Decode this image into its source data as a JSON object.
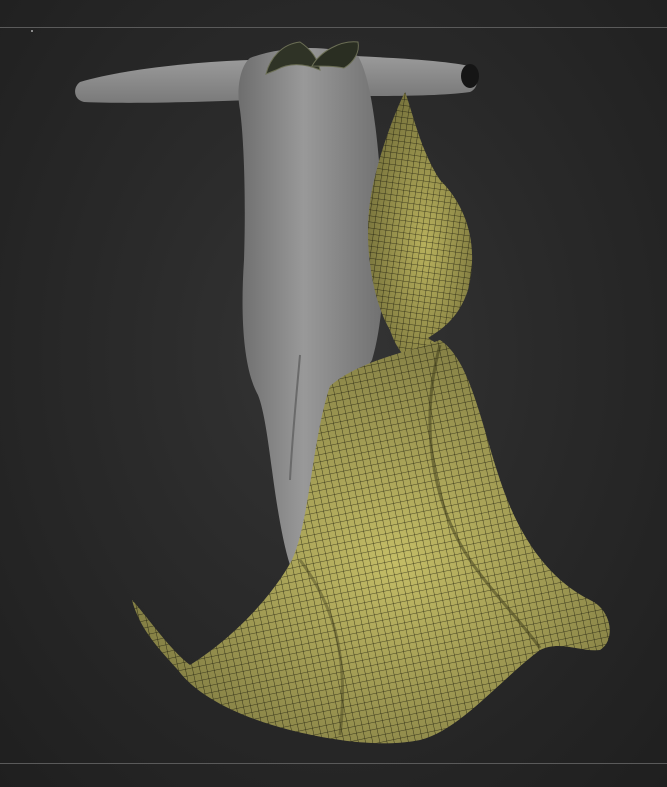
{
  "viewport": {
    "background": "#2a2a2a",
    "frame_line_color": "#5a5a5a"
  },
  "model": {
    "body_color": "#8c8c8c",
    "cloth_color": "#c8c06a",
    "cloth_wire_color": "#1a1a10",
    "collar_color": "#2a2e22"
  }
}
